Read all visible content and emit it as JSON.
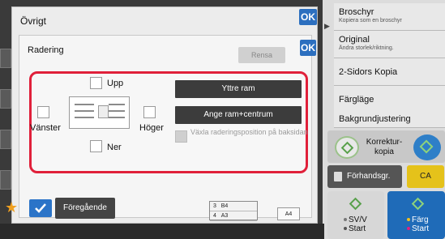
{
  "dialog": {
    "title": "Övrigt",
    "ok_label": "OK",
    "sub_title": "Radering",
    "sub_ok_label": "OK",
    "clear_label": "Rensa"
  },
  "erase": {
    "top_label": "Upp",
    "bottom_label": "Ner",
    "left_label": "Vänster",
    "right_label": "Höger",
    "outer_frame_label": "Yttre ram",
    "frame_center_label": "Ange ram+centrum",
    "toggle_back_label": "Växla raderingsposition på baksidan"
  },
  "functions": [
    {
      "title": "Broschyr",
      "subtitle": "Kopiera som en broschyr"
    },
    {
      "title": "Original",
      "subtitle": "Ändra storlek/riktning."
    },
    {
      "title": "2-Sidors Kopia",
      "subtitle": ""
    },
    {
      "title": "Färgläge",
      "subtitle": ""
    },
    {
      "title": "Bakgrundjustering",
      "subtitle": ""
    }
  ],
  "proof_copy_label": "Korrektur-kopia",
  "preview_label": "Förhandsgr.",
  "ca_label": "CA",
  "start_bw": {
    "line1": "SV/V",
    "line2": "Start"
  },
  "start_color": {
    "line1": "Färg",
    "line2": "Start"
  },
  "bottom": {
    "previous_label": "Föregående",
    "tray_rows": [
      {
        "num": "3",
        "size": "B4"
      },
      {
        "num": "4",
        "size": "A3"
      }
    ],
    "paper_size": "A4"
  },
  "colors": {
    "accent_red": "#e0203a",
    "ok_blue": "#2c6fbf",
    "ca_yellow": "#e5c21a",
    "color_start_blue": "#1f6bb8"
  }
}
